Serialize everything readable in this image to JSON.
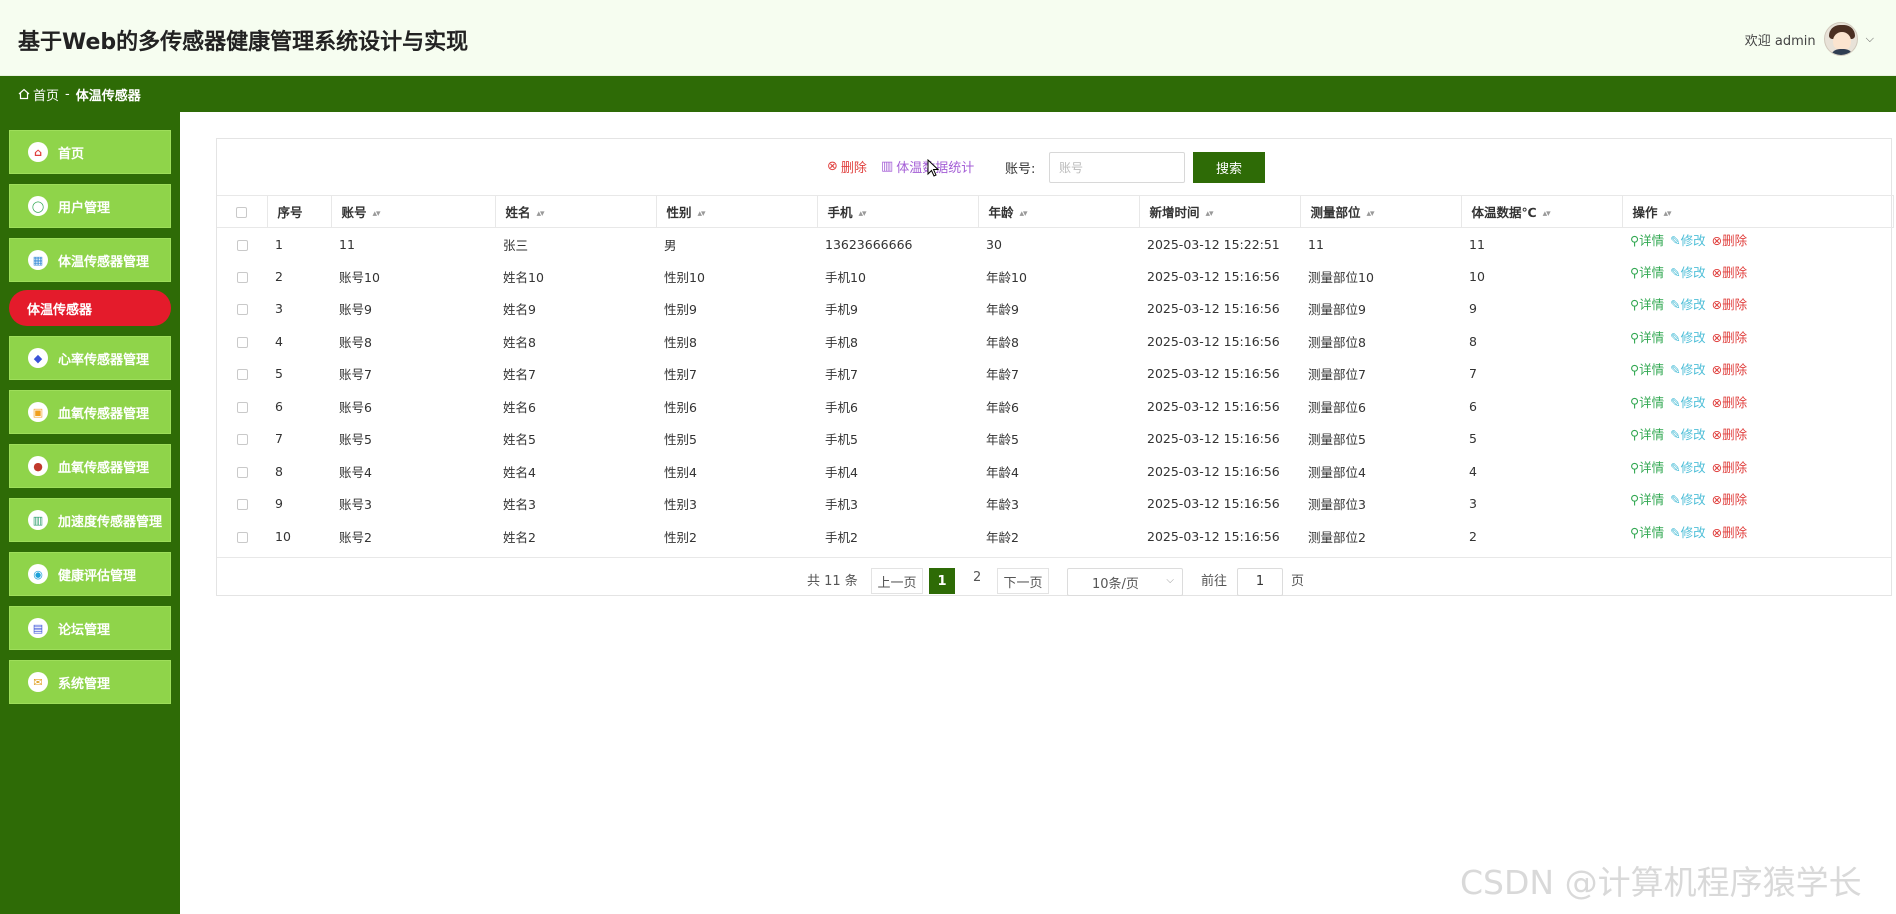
{
  "app": {
    "title": "基于Web的多传感器健康管理系统设计与实现",
    "welcome": "欢迎 admin"
  },
  "breadcrumb": {
    "home": "首页",
    "separator": "-",
    "current": "体温传感器"
  },
  "sidebar": {
    "items": [
      {
        "label": "首页",
        "icon": "home-icon",
        "glyph": "⌂",
        "color": "#e0403e"
      },
      {
        "label": "用户管理",
        "icon": "user-icon",
        "glyph": "◯",
        "color": "#32a852"
      },
      {
        "label": "体温传感器管理",
        "icon": "grid-icon",
        "glyph": "▦",
        "color": "#3b8ed8"
      },
      {
        "label": "心率传感器管理",
        "icon": "heart-rate-icon",
        "glyph": "◆",
        "color": "#3a52d8"
      },
      {
        "label": "血氧传感器管理",
        "icon": "box-icon",
        "glyph": "▣",
        "color": "#f0a020"
      },
      {
        "label": "血氧传感器管理",
        "icon": "disc-icon",
        "glyph": "●",
        "color": "#c0392b"
      },
      {
        "label": "加速度传感器管理",
        "icon": "book-icon",
        "glyph": "▥",
        "color": "#2a9d6a"
      },
      {
        "label": "健康评估管理",
        "icon": "globe-icon",
        "glyph": "◉",
        "color": "#1ca0d8"
      },
      {
        "label": "论坛管理",
        "icon": "list-icon",
        "glyph": "▤",
        "color": "#3a52d8"
      },
      {
        "label": "系统管理",
        "icon": "mail-icon",
        "glyph": "✉",
        "color": "#e0a020"
      }
    ],
    "active_sub": "体温传感器"
  },
  "toolbar": {
    "delete_label": "删除",
    "stats_label": "体温数据统计",
    "account_label": "账号:",
    "search_placeholder": "账号",
    "search_button": "搜索"
  },
  "table": {
    "headers": [
      "序号",
      "账号",
      "姓名",
      "性别",
      "手机",
      "年龄",
      "新增时间",
      "测量部位",
      "体温数据℃",
      "操作"
    ],
    "rows": [
      [
        "1",
        "11",
        "张三",
        "男",
        "13623666666",
        "30",
        "2025-03-12 15:22:51",
        "11",
        "11"
      ],
      [
        "2",
        "账号10",
        "姓名10",
        "性别10",
        "手机10",
        "年龄10",
        "2025-03-12 15:16:56",
        "测量部位10",
        "10"
      ],
      [
        "3",
        "账号9",
        "姓名9",
        "性别9",
        "手机9",
        "年龄9",
        "2025-03-12 15:16:56",
        "测量部位9",
        "9"
      ],
      [
        "4",
        "账号8",
        "姓名8",
        "性别8",
        "手机8",
        "年龄8",
        "2025-03-12 15:16:56",
        "测量部位8",
        "8"
      ],
      [
        "5",
        "账号7",
        "姓名7",
        "性别7",
        "手机7",
        "年龄7",
        "2025-03-12 15:16:56",
        "测量部位7",
        "7"
      ],
      [
        "6",
        "账号6",
        "姓名6",
        "性别6",
        "手机6",
        "年龄6",
        "2025-03-12 15:16:56",
        "测量部位6",
        "6"
      ],
      [
        "7",
        "账号5",
        "姓名5",
        "性别5",
        "手机5",
        "年龄5",
        "2025-03-12 15:16:56",
        "测量部位5",
        "5"
      ],
      [
        "8",
        "账号4",
        "姓名4",
        "性别4",
        "手机4",
        "年龄4",
        "2025-03-12 15:16:56",
        "测量部位4",
        "4"
      ],
      [
        "9",
        "账号3",
        "姓名3",
        "性别3",
        "手机3",
        "年龄3",
        "2025-03-12 15:16:56",
        "测量部位3",
        "3"
      ],
      [
        "10",
        "账号2",
        "姓名2",
        "性别2",
        "手机2",
        "年龄2",
        "2025-03-12 15:16:56",
        "测量部位2",
        "2"
      ]
    ],
    "actions": {
      "detail": "详情",
      "edit": "修改",
      "delete": "删除"
    }
  },
  "pagination": {
    "total": "共 11 条",
    "prev": "上一页",
    "current": "1",
    "next_page": "2",
    "next": "下一页",
    "page_size": "10条/页",
    "goto_label": "前往",
    "goto_value": "1",
    "page_unit": "页"
  },
  "watermark": "CSDN @计算机程序猿学长"
}
